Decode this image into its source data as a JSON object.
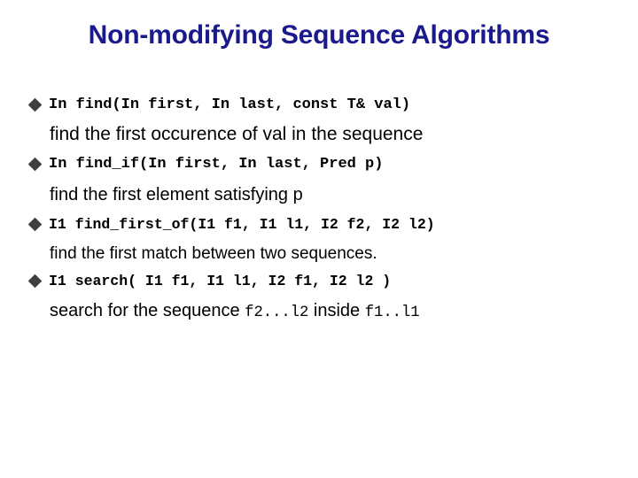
{
  "slide": {
    "title": "Non-modifying Sequence Algorithms",
    "title_color": "#1a1a8c",
    "background_color": "#ffffff",
    "bullet_icon": "diamond-bullet-icon",
    "bullet_color": "#3f3f3f",
    "entries": [
      {
        "signature": "In find(In first, In last, const T& val)",
        "description_prefix": "find the first occurence of val in the sequence",
        "description_mono_1": "",
        "description_middle": "",
        "description_mono_2": "",
        "description_suffix": ""
      },
      {
        "signature": "In find_if(In first, In last, Pred p)",
        "description_prefix": "find the first element satisfying p",
        "description_mono_1": "",
        "description_middle": "",
        "description_mono_2": "",
        "description_suffix": ""
      },
      {
        "signature": "I1 find_first_of(I1 f1, I1 l1, I2 f2, I2 l2)",
        "description_prefix": "find the first match between two sequences.",
        "description_mono_1": "",
        "description_middle": "",
        "description_mono_2": "",
        "description_suffix": ""
      },
      {
        "signature": "I1 search( I1 f1, I1 l1, I2 f1, I2 l2 )",
        "description_prefix": "search for the sequence ",
        "description_mono_1": "f2...l2",
        "description_middle": " inside ",
        "description_mono_2": "f1..l1",
        "description_suffix": ""
      }
    ]
  }
}
